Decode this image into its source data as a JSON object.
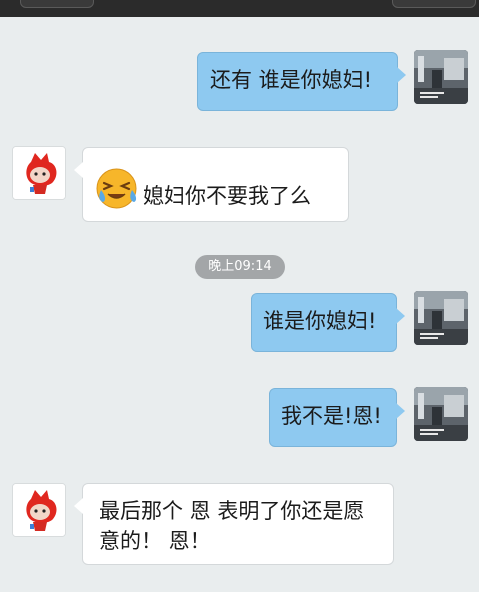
{
  "messages": [
    {
      "direction": "out",
      "text": "还有 谁是你媳妇!"
    },
    {
      "direction": "in",
      "emoji": "crying-laughing-face",
      "text": "媳妇你不要我了么"
    },
    {
      "direction": "out",
      "text": "谁是你媳妇!"
    },
    {
      "direction": "out",
      "text": "我不是!恩!"
    },
    {
      "direction": "in",
      "text": "最后那个 恩 表明了你还是愿意的！ 恩！"
    }
  ],
  "timestamp": "晚上09:14",
  "colors": {
    "outgoing_bubble": "#8ec9f0",
    "incoming_bubble": "#ffffff",
    "background": "#e9edee",
    "timestamp_pill": "#a3a6a8"
  }
}
